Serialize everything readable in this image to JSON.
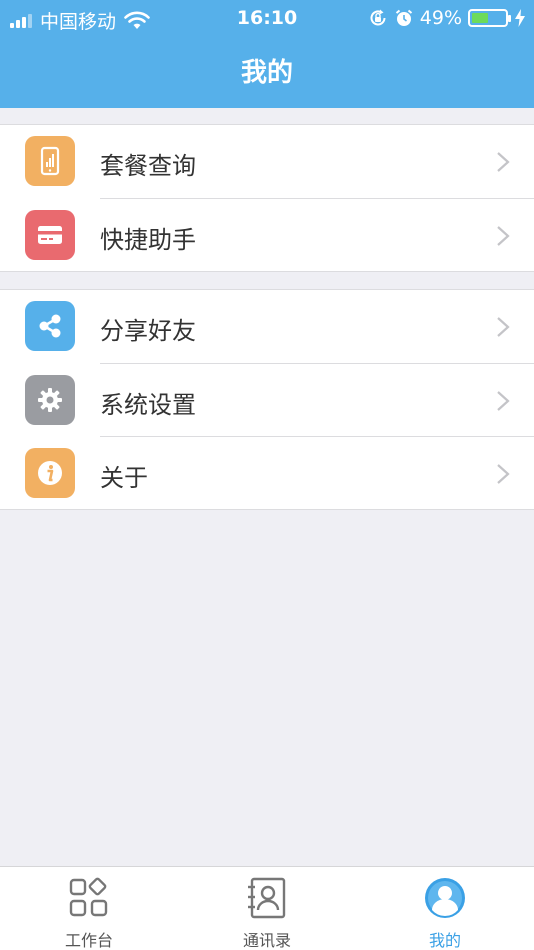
{
  "status_bar": {
    "carrier": "中国移动",
    "time": "16:10",
    "battery": "49%",
    "battery_level": 0.49
  },
  "nav": {
    "title": "我的"
  },
  "menu": {
    "group1": [
      {
        "label": "套餐查询",
        "icon": "phone-chart-icon",
        "color": "#f2b062"
      },
      {
        "label": "快捷助手",
        "icon": "card-icon",
        "color": "#e96a6f"
      }
    ],
    "group2": [
      {
        "label": "分享好友",
        "icon": "share-icon",
        "color": "#56b0ea"
      },
      {
        "label": "系统设置",
        "icon": "gear-icon",
        "color": "#9a9ca1"
      },
      {
        "label": "关于",
        "icon": "info-icon",
        "color": "#f2b062"
      }
    ]
  },
  "tabbar": {
    "tabs": [
      {
        "label": "工作台",
        "icon": "grid-icon",
        "active": false
      },
      {
        "label": "通讯录",
        "icon": "contacts-icon",
        "active": false
      },
      {
        "label": "我的",
        "icon": "user-icon",
        "active": true
      }
    ],
    "active_color": "#3aa0e5"
  },
  "colors": {
    "header": "#56b0ea",
    "background": "#efeff4"
  }
}
